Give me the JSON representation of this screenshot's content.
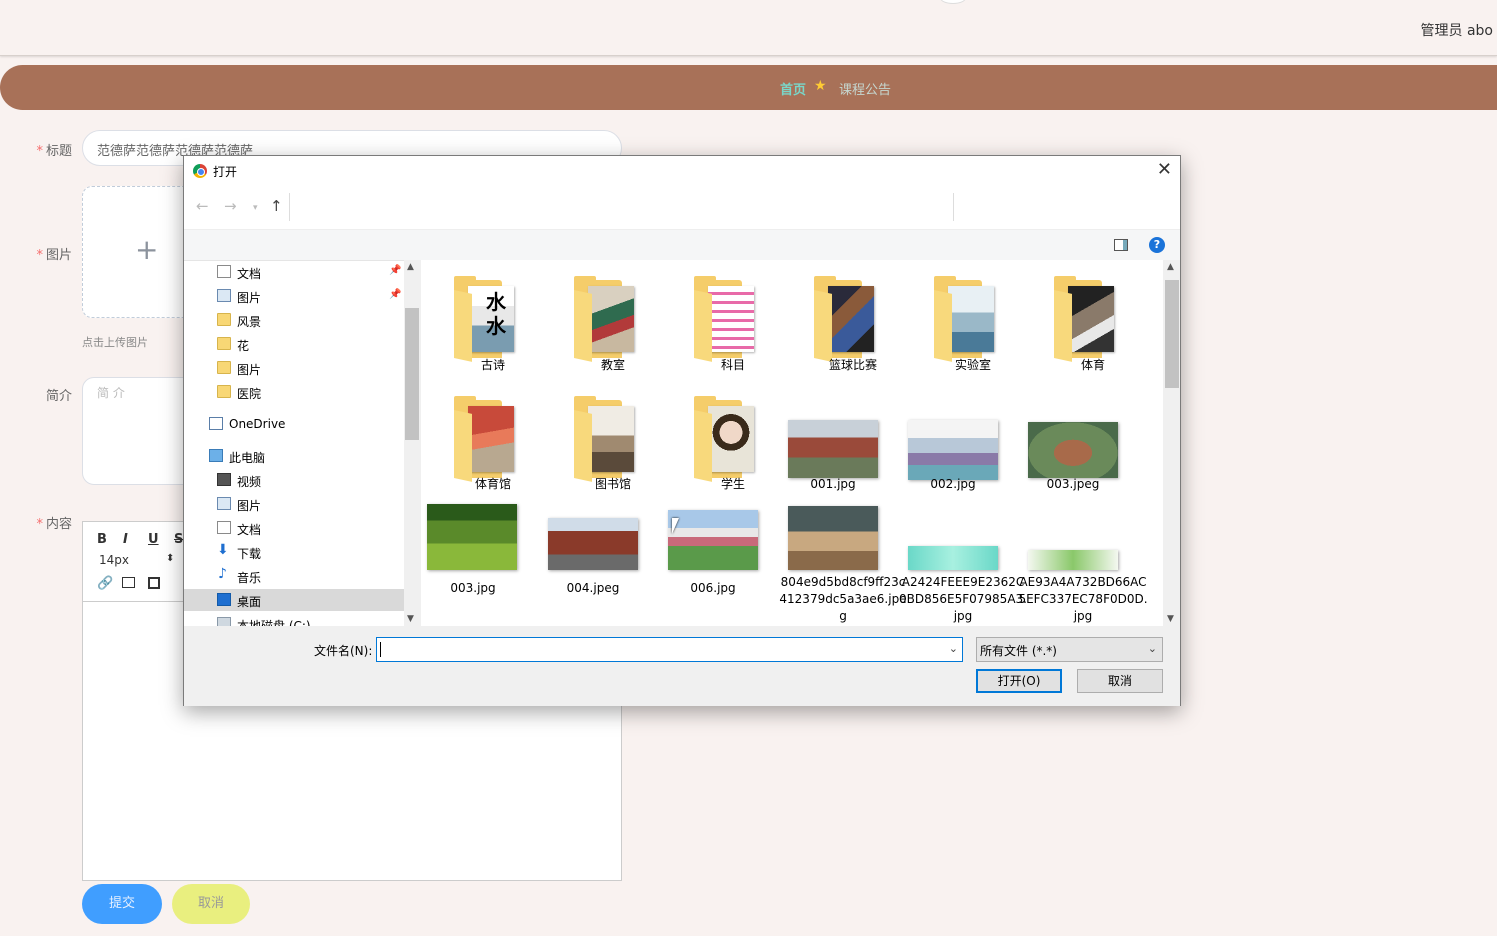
{
  "header": {
    "user_text": "管理员 abo"
  },
  "nav": {
    "home": "首页",
    "star": "★",
    "notice": "课程公告"
  },
  "form": {
    "title_label": "标题",
    "title_value": "范德萨范德萨范德萨范德萨",
    "image_label": "图片",
    "upload_plus": "+",
    "upload_tip": "点击上传图片",
    "intro_label": "简介",
    "intro_placeholder": "简 介",
    "content_label": "内容",
    "required_mark": "*",
    "font_size": "14px",
    "submit": "提交",
    "cancel": "取消"
  },
  "dialog": {
    "title": "打开",
    "close": "✕",
    "help": "?",
    "nav_items": [
      {
        "label": "文档",
        "icon": "document-icon",
        "pinned": true
      },
      {
        "label": "图片",
        "icon": "pictures-icon",
        "pinned": true
      },
      {
        "label": "风景",
        "icon": "folder-icon"
      },
      {
        "label": "花",
        "icon": "folder-icon"
      },
      {
        "label": "图片",
        "icon": "folder-icon"
      },
      {
        "label": "医院",
        "icon": "folder-icon"
      },
      {
        "label": "OneDrive",
        "icon": "onedrive-icon"
      },
      {
        "label": "此电脑",
        "icon": "computer-icon"
      },
      {
        "label": "视频",
        "icon": "video-icon"
      },
      {
        "label": "图片",
        "icon": "pictures-icon"
      },
      {
        "label": "文档",
        "icon": "document-icon"
      },
      {
        "label": "下载",
        "icon": "download-icon"
      },
      {
        "label": "音乐",
        "icon": "music-icon"
      },
      {
        "label": "桌面",
        "icon": "desktop-icon",
        "selected": true
      },
      {
        "label": "本地磁盘 (C:)",
        "icon": "disk-icon"
      }
    ],
    "files": [
      {
        "name": "古诗",
        "type": "folder"
      },
      {
        "name": "教室",
        "type": "folder"
      },
      {
        "name": "科目",
        "type": "folder"
      },
      {
        "name": "篮球比赛",
        "type": "folder"
      },
      {
        "name": "实验室",
        "type": "folder"
      },
      {
        "name": "体育",
        "type": "folder"
      },
      {
        "name": "体育馆",
        "type": "folder"
      },
      {
        "name": "图书馆",
        "type": "folder"
      },
      {
        "name": "学生",
        "type": "folder"
      },
      {
        "name": "001.jpg",
        "type": "image"
      },
      {
        "name": "002.jpg",
        "type": "image"
      },
      {
        "name": "003.jpeg",
        "type": "image"
      },
      {
        "name": "003.jpg",
        "type": "image"
      },
      {
        "name": "004.jpeg",
        "type": "image"
      },
      {
        "name": "006.jpg",
        "type": "image"
      },
      {
        "name": "804e9d5bd8cf9ff23c412379dc5a3ae6.jpeg",
        "type": "image"
      },
      {
        "name": "A2424FEEE9E2362C0BD856E5F07985A3.jpg",
        "type": "image"
      },
      {
        "name": "AE93A4A732BD66AC5EFC337EC78F0D0D.jpg",
        "type": "image"
      }
    ],
    "filename_label": "文件名(N):",
    "filename_value": "",
    "filetype": "所有文件 (*.*)",
    "open_button": "打开(O)",
    "cancel_button": "取消"
  }
}
